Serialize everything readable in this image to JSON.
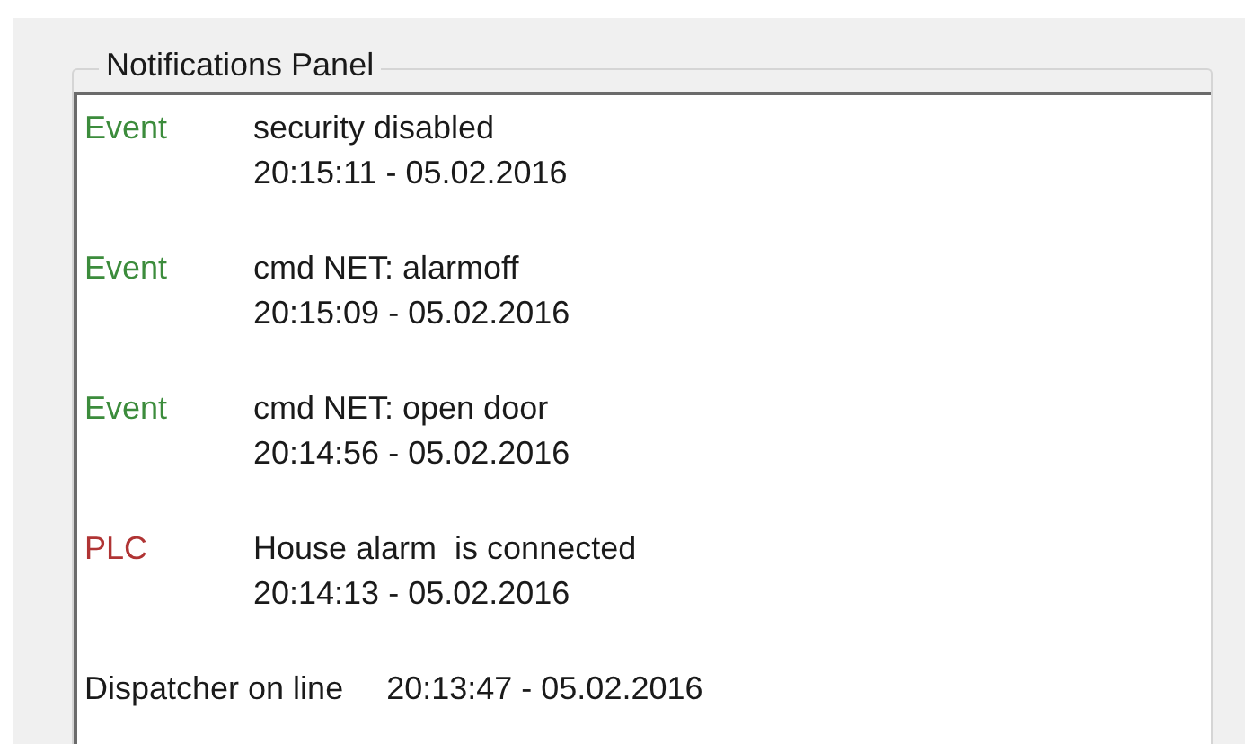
{
  "panel": {
    "title": "Notifications Panel"
  },
  "notifications": [
    {
      "kind": "event",
      "source": "Event",
      "color": "#3c8c3c",
      "message": "security disabled",
      "time": "20:15:11 - 05.02.2016"
    },
    {
      "kind": "event",
      "source": "Event",
      "color": "#3c8c3c",
      "message": "cmd NET: alarmoff",
      "time": "20:15:09 - 05.02.2016"
    },
    {
      "kind": "event",
      "source": "Event",
      "color": "#3c8c3c",
      "message": "cmd NET: open door",
      "time": "20:14:56 - 05.02.2016"
    },
    {
      "kind": "event",
      "source": "PLC",
      "color": "#b03434",
      "message": "House alarm  is connected",
      "time": "20:14:13 - 05.02.2016"
    },
    {
      "kind": "status",
      "message": "Dispatcher on line",
      "time": "20:13:47 - 05.02.2016"
    }
  ]
}
